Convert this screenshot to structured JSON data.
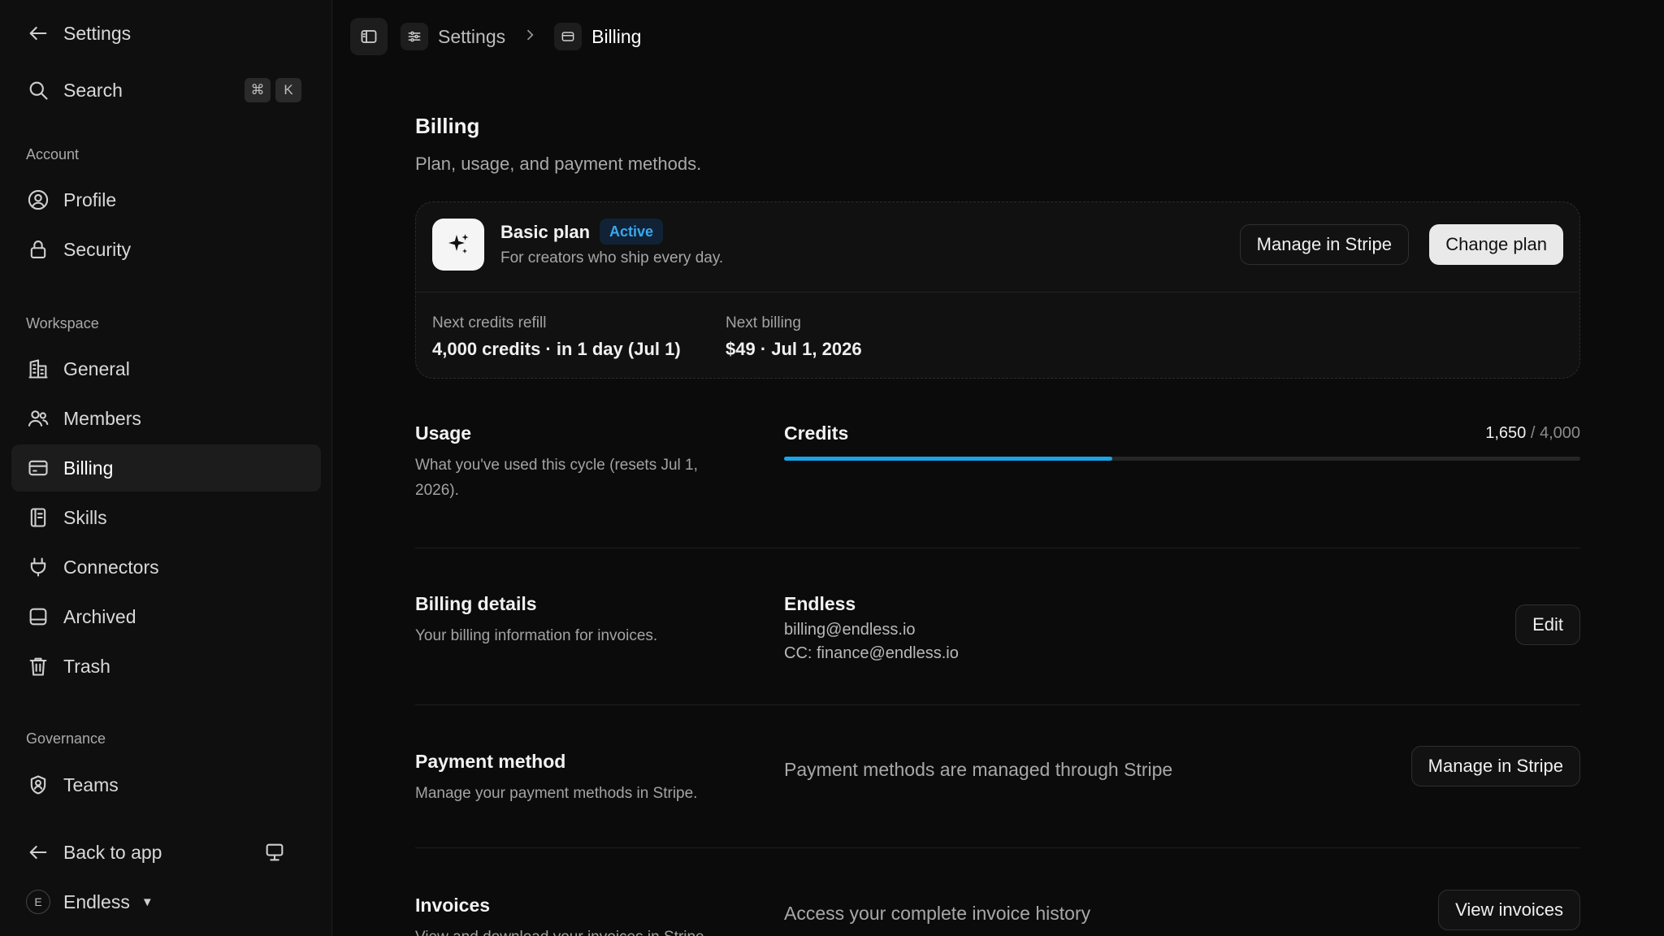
{
  "sidebar": {
    "back_label": "Settings",
    "search": {
      "label": "Search",
      "keys": [
        "⌘",
        "K"
      ]
    },
    "sections": {
      "account": "Account",
      "workspace": "Workspace",
      "governance": "Governance"
    },
    "items": {
      "profile": "Profile",
      "security": "Security",
      "general": "General",
      "members": "Members",
      "billing": "Billing",
      "skills": "Skills",
      "connectors": "Connectors",
      "archived": "Archived",
      "trash": "Trash",
      "teams": "Teams"
    },
    "back_to_app": "Back to app",
    "workspace_switcher": {
      "initial": "E",
      "name": "Endless"
    }
  },
  "breadcrumb": {
    "root": "Settings",
    "current": "Billing"
  },
  "page": {
    "title": "Billing",
    "subtitle": "Plan, usage, and payment methods."
  },
  "plan": {
    "name": "Basic plan",
    "status": "Active",
    "tagline": "For creators who ship every day.",
    "manage_label": "Manage in Stripe",
    "change_label": "Change plan",
    "refill_label": "Next credits refill",
    "refill_value": "4,000 credits · in 1 day (Jul 1)",
    "billing_label": "Next billing",
    "billing_value": "$49 · Jul 1, 2026"
  },
  "usage": {
    "title": "Usage",
    "desc": "What you've used this cycle (resets Jul 1, 2026).",
    "credits_label": "Credits",
    "used": "1,650",
    "total": "/ 4,000",
    "used_fraction": 0.4125
  },
  "billing_details": {
    "title": "Billing details",
    "desc": "Your billing information for invoices.",
    "company": "Endless",
    "email": "billing@endless.io",
    "cc": "CC: finance@endless.io",
    "edit_label": "Edit"
  },
  "payment_method": {
    "title": "Payment method",
    "desc": "Manage your payment methods in Stripe.",
    "info": "Payment methods are managed through Stripe",
    "button_label": "Manage in Stripe"
  },
  "invoices": {
    "title": "Invoices",
    "desc": "View and download your invoices in Stripe.",
    "info": "Access your complete invoice history",
    "button_label": "View invoices"
  },
  "colors": {
    "accent": "#1aa3e8",
    "badge_bg": "#112236",
    "badge_text": "#3aa8f0"
  }
}
